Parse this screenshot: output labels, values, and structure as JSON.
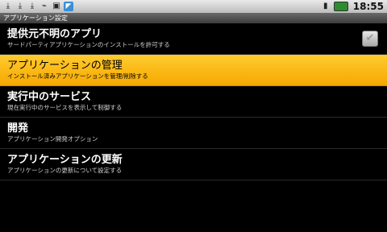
{
  "status_bar": {
    "left_icons": [
      "download-icon",
      "download-icon",
      "download-icon",
      "usb-icon",
      "sd-card-icon",
      "app-notification-icon"
    ],
    "right_icons": [
      "sim-icon",
      "battery-icon"
    ],
    "time": "18:55"
  },
  "title_bar": {
    "title": "アプリケーション設定"
  },
  "settings": [
    {
      "title": "提供元不明のアプリ",
      "summary": "サードパーティアプリケーションのインストールを許可する",
      "has_checkbox": true,
      "checked": false
    },
    {
      "title": "アプリケーションの管理",
      "summary": "インストール済みアプリケーションを管理/削除する",
      "selected": true
    },
    {
      "title": "実行中のサービス",
      "summary": "現在実行中のサービスを表示して制御する"
    },
    {
      "title": "開発",
      "summary": "アプリケーション開発オプション"
    },
    {
      "title": "アプリケーションの更新",
      "summary": "アプリケーションの更新について設定する"
    }
  ],
  "colors": {
    "highlight": "#f6a800",
    "background": "#000000"
  }
}
